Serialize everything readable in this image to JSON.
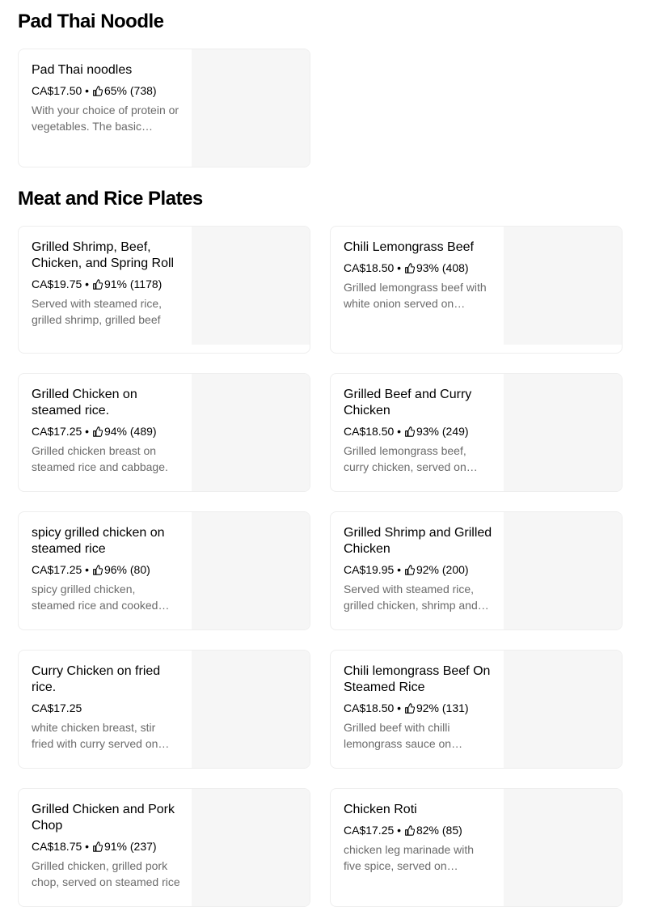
{
  "sections": [
    {
      "title": "Pad Thai Noodle",
      "items": [
        {
          "name": "Pad Thai noodles",
          "price": "CA$17.50",
          "rating": "65% (738)",
          "desc": "With your choice of protein or vegetables. The basic ingredients"
        }
      ]
    },
    {
      "title": "Meat and Rice Plates",
      "items": [
        {
          "name": "Grilled Shrimp, Beef, Chicken, and Spring Roll",
          "price": "CA$19.75",
          "rating": "91% (1178)",
          "desc": "Served with steamed rice, grilled shrimp, grilled beef"
        },
        {
          "name": "Chili Lemongrass Beef",
          "price": "CA$18.50",
          "rating": "93% (408)",
          "desc": "Grilled lemongrass beef with white onion served on steamed rice"
        },
        {
          "name": "Grilled Chicken on steamed rice.",
          "price": "CA$17.25",
          "rating": "94% (489)",
          "desc": "Grilled chicken breast on steamed rice and cabbage."
        },
        {
          "name": "Grilled Beef and Curry Chicken",
          "price": "CA$18.50",
          "rating": "93% (249)",
          "desc": "Grilled lemongrass beef, curry chicken, served on steamed rice"
        },
        {
          "name": "spicy grilled chicken on steamed rice",
          "price": "CA$17.25",
          "rating": "96% (80)",
          "desc": "spicy grilled chicken, steamed rice and cooked cabbage"
        },
        {
          "name": "Grilled Shrimp and Grilled Chicken",
          "price": "CA$19.95",
          "rating": "92% (200)",
          "desc": "Served with steamed rice, grilled chicken, shrimp and cabbage"
        },
        {
          "name": "Curry Chicken on fried rice.",
          "price": "CA$17.25",
          "rating": "",
          "desc": "white chicken breast, stir fried with curry served on fried rice"
        },
        {
          "name": "Chili lemongrass Beef On Steamed Rice",
          "price": "CA$18.50",
          "rating": "92% (131)",
          "desc": "Grilled beef with chilli lemongrass sauce on steamed rice"
        },
        {
          "name": "Grilled Chicken and Pork Chop",
          "price": "CA$18.75",
          "rating": "91% (237)",
          "desc": "Grilled chicken, grilled pork chop, served on steamed rice"
        },
        {
          "name": "Chicken Roti",
          "price": "CA$17.25",
          "rating": "82% (85)",
          "desc": "chicken leg marinade with five spice, served on steamed rice"
        }
      ]
    }
  ],
  "separator": " • ",
  "icons": {
    "rating": "thumbs-up-icon"
  }
}
